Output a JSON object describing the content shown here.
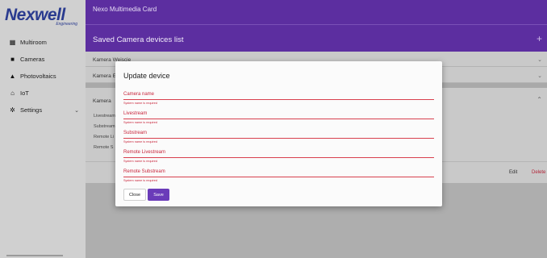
{
  "brand": {
    "name": "Nexwell",
    "subtitle": "Engineering"
  },
  "sidebar": {
    "items": [
      {
        "label": "Multiroom",
        "icon": "building-icon"
      },
      {
        "label": "Cameras",
        "icon": "camera-icon"
      },
      {
        "label": "Photovoltaics",
        "icon": "solar-panel-icon"
      },
      {
        "label": "IoT",
        "icon": "home-icon"
      },
      {
        "label": "Settings",
        "icon": "gear-icon",
        "has_chevron": true
      }
    ]
  },
  "header": {
    "app_title": "Nexo Multimedia Card",
    "list_title": "Saved Camera devices list",
    "add_icon": "plus-icon"
  },
  "list": {
    "rows": [
      {
        "label": "Kamera Wejscie"
      },
      {
        "label": "Kamera E"
      },
      {
        "label": "Kamera"
      }
    ],
    "expanded_fields": [
      "Livestream",
      "Substream",
      "Remote Li",
      "Remote S"
    ],
    "edit_label": "Edit",
    "delete_label": "Delete"
  },
  "modal": {
    "title": "Update device",
    "fields": [
      {
        "label": "Camera name",
        "error": "System name is required"
      },
      {
        "label": "Livestream",
        "error": "System name is required"
      },
      {
        "label": "Substream",
        "error": "System name is required"
      },
      {
        "label": "Remote Livestream",
        "error": "System name is required"
      },
      {
        "label": "Remote Substream",
        "error": "System name is required"
      }
    ],
    "close_label": "Close",
    "save_label": "Save"
  },
  "colors": {
    "header": "#5c2ea0",
    "accent": "#6a3bb9",
    "error": "#c8263c",
    "brand": "#2a3b8f"
  }
}
